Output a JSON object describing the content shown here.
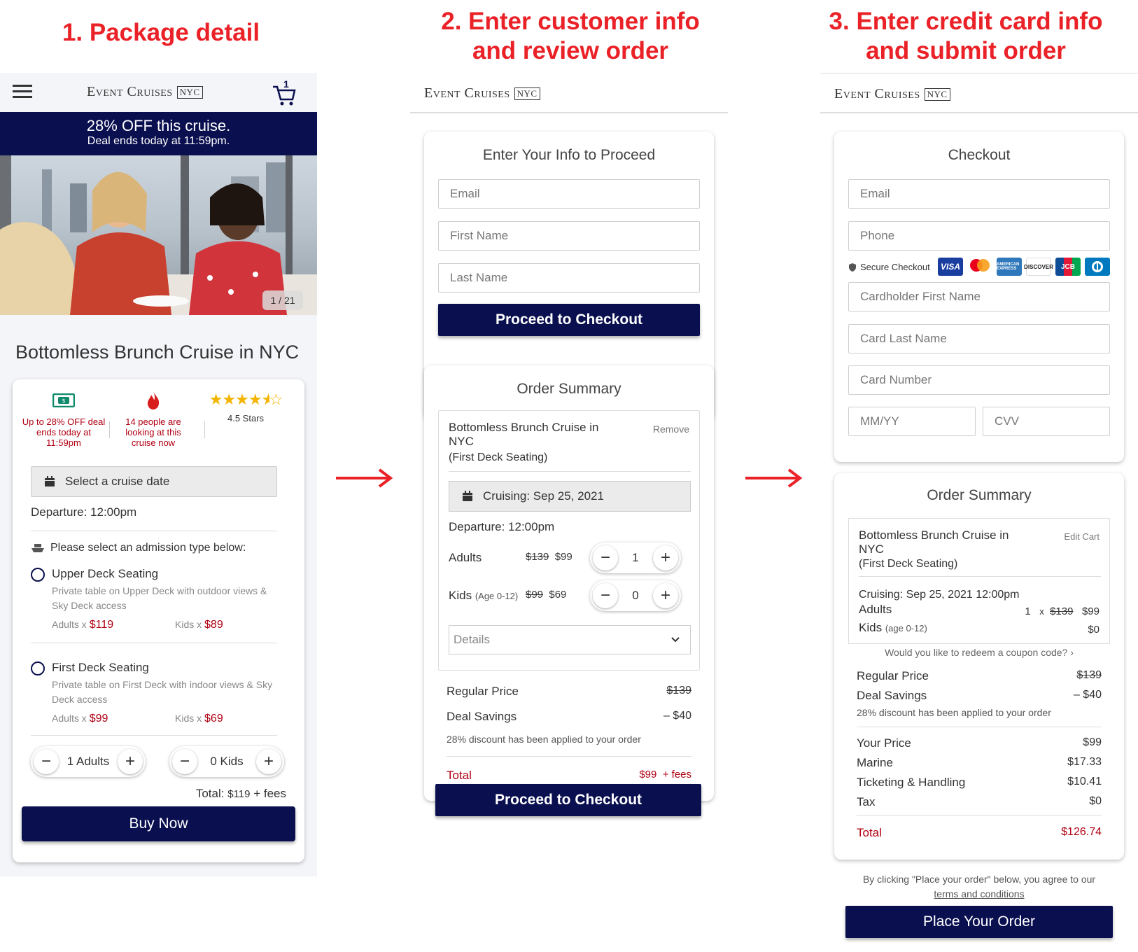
{
  "steps": {
    "s1": "1. Package detail",
    "s2_l1": "2. Enter customer info",
    "s2_l2": "and review order",
    "s3_l1": "3. Enter credit card info",
    "s3_l2": "and submit order"
  },
  "brand": {
    "name": "Event Cruises",
    "badge": "NYC"
  },
  "p1": {
    "cart_count": "1",
    "promo_title": "28% OFF this cruise.",
    "promo_sub": "Deal ends today at 11:59pm.",
    "photo_counter": "1 / 21",
    "title": "Bottomless Brunch Cruise in NYC",
    "feature1": "Up to 28% OFF deal ends today at 11:59pm",
    "feature2": "14 people are looking at this cruise now",
    "feature3": "4.5 Stars",
    "rating": 4.5,
    "date_btn": "Select a cruise date",
    "departure": "Departure: 12:00pm",
    "admission_prompt": "Please select an admission type below:",
    "options": [
      {
        "name": "Upper Deck Seating",
        "desc": "Private table on Upper Deck with outdoor views & Sky Deck access",
        "adults_label": "Adults x",
        "adults_price": "$119",
        "kids_label": "Kids x",
        "kids_price": "$89"
      },
      {
        "name": "First Deck Seating",
        "desc": "Private table on First Deck with indoor views & Sky Deck access",
        "adults_label": "Adults x",
        "adults_price": "$99",
        "kids_label": "Kids x",
        "kids_price": "$69"
      }
    ],
    "adults_stepper": "1 Adults",
    "kids_stepper": "0 Kids",
    "total_label": "Total:",
    "total_value": "$119",
    "total_fees": "+ fees",
    "buy_btn": "Buy Now"
  },
  "p2": {
    "form_title": "Enter Your Info to Proceed",
    "email_ph": "Email",
    "first_ph": "First Name",
    "last_ph": "Last Name",
    "proceed_btn": "Proceed to Checkout",
    "summary_title": "Order Summary",
    "item_name": "Bottomless Brunch Cruise in NYC",
    "item_variant": "(First Deck Seating)",
    "remove": "Remove",
    "cruising": "Cruising:  Sep 25, 2021",
    "departure": "Departure: 12:00pm",
    "adults_label": "Adults",
    "adults_old": "$139",
    "adults_new": "$99",
    "adults_qty": "1",
    "kids_label": "Kids",
    "kids_age": "(Age 0-12)",
    "kids_old": "$99",
    "kids_new": "$69",
    "kids_qty": "0",
    "details": "Details",
    "regular_label": "Regular Price",
    "regular_value": "$139",
    "savings_label": "Deal Savings",
    "savings_value": "– $40",
    "discount_note": "28% discount has been applied to your order",
    "total_label": "Total",
    "total_value": "$99",
    "total_fees": "+ fees",
    "proceed_btn2": "Proceed to Checkout"
  },
  "p3": {
    "checkout_title": "Checkout",
    "email_ph": "Email",
    "phone_ph": "Phone",
    "secure": "Secure Checkout",
    "card_logos": [
      "VISA",
      "mastercard",
      "AMERICAN EXPRESS",
      "DISCOVER",
      "JCB",
      "Diners"
    ],
    "cfirst_ph": "Cardholder First Name",
    "clast_ph": "Card Last Name",
    "cnum_ph": "Card Number",
    "mmyy_ph": "MM/YY",
    "cvv_ph": "CVV",
    "summary_title": "Order Summary",
    "item_name": "Bottomless Brunch Cruise in NYC",
    "item_variant": "(First Deck Seating)",
    "edit_cart": "Edit Cart",
    "cruising": "Cruising: Sep 25, 2021 12:00pm",
    "adults_label": "Adults",
    "adults_qty": "1",
    "adults_x": "x",
    "adults_old": "$139",
    "adults_new": "$99",
    "kids_label": "Kids",
    "kids_age": "(age 0-12)",
    "kids_value": "$0",
    "coupon": "Would you like to redeem a coupon code?",
    "regular_label": "Regular Price",
    "regular_value": "$139",
    "savings_label": "Deal Savings",
    "savings_value": "– $40",
    "discount_note": "28% discount has been applied to your order",
    "your_price_label": "Your Price",
    "your_price_value": "$99",
    "marine_label": "Marine",
    "marine_value": "$17.33",
    "ticketing_label": "Ticketing & Handling",
    "ticketing_value": "$10.41",
    "tax_label": "Tax",
    "tax_value": "$0",
    "total_label": "Total",
    "total_value": "$126.74",
    "agree_text": "By clicking \"Place your order\" below, you agree to our",
    "terms": "terms and conditions",
    "place_btn": "Place Your Order"
  },
  "colors": {
    "navy": "#0a0f4f",
    "red_title": "#ea2127",
    "price_red": "#b00012",
    "money_green": "#0f8a6c"
  }
}
